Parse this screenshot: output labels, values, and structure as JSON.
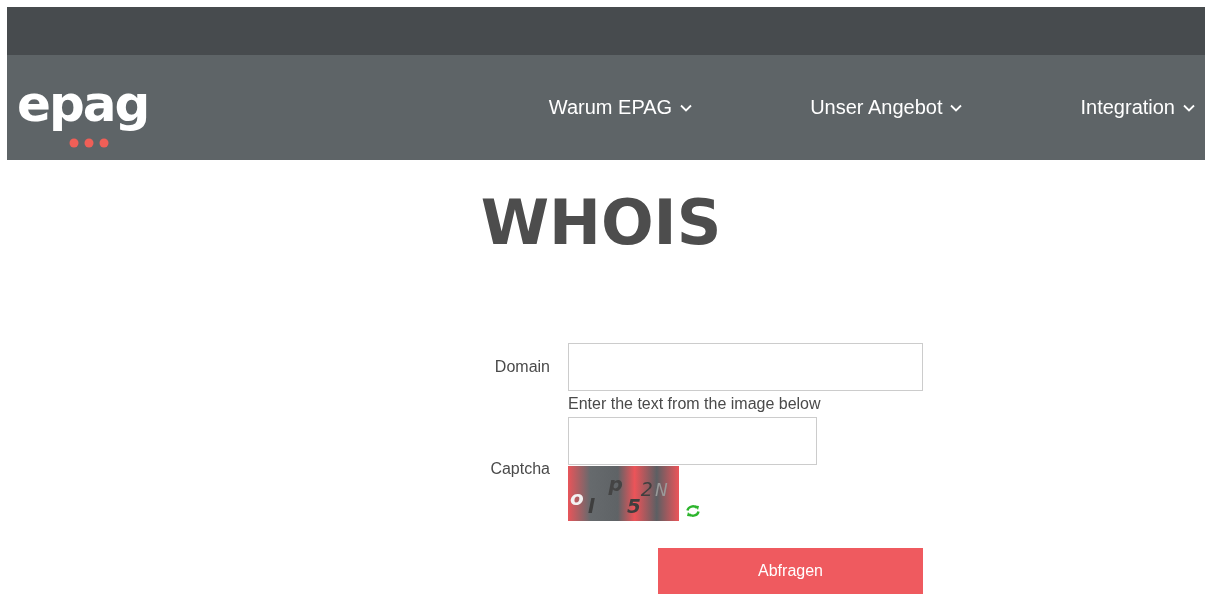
{
  "header": {
    "logo": "epag",
    "nav": [
      {
        "label": "Warum EPAG"
      },
      {
        "label": "Unser Angebot"
      },
      {
        "label": "Integration"
      }
    ]
  },
  "heading": "WHOIS",
  "form": {
    "domain_label": "Domain",
    "captcha_hint": "Enter the text from the image below",
    "captcha_label": "Captcha",
    "captcha_characters": [
      {
        "char": "o",
        "kind": "low"
      },
      {
        "char": "l",
        "kind": "lower"
      },
      {
        "char": "p",
        "kind": "high"
      },
      {
        "char": "5",
        "kind": "lower"
      },
      {
        "char": "2",
        "kind": "thin"
      },
      {
        "char": "N",
        "kind": "thin"
      }
    ],
    "submit": "Abfragen"
  }
}
